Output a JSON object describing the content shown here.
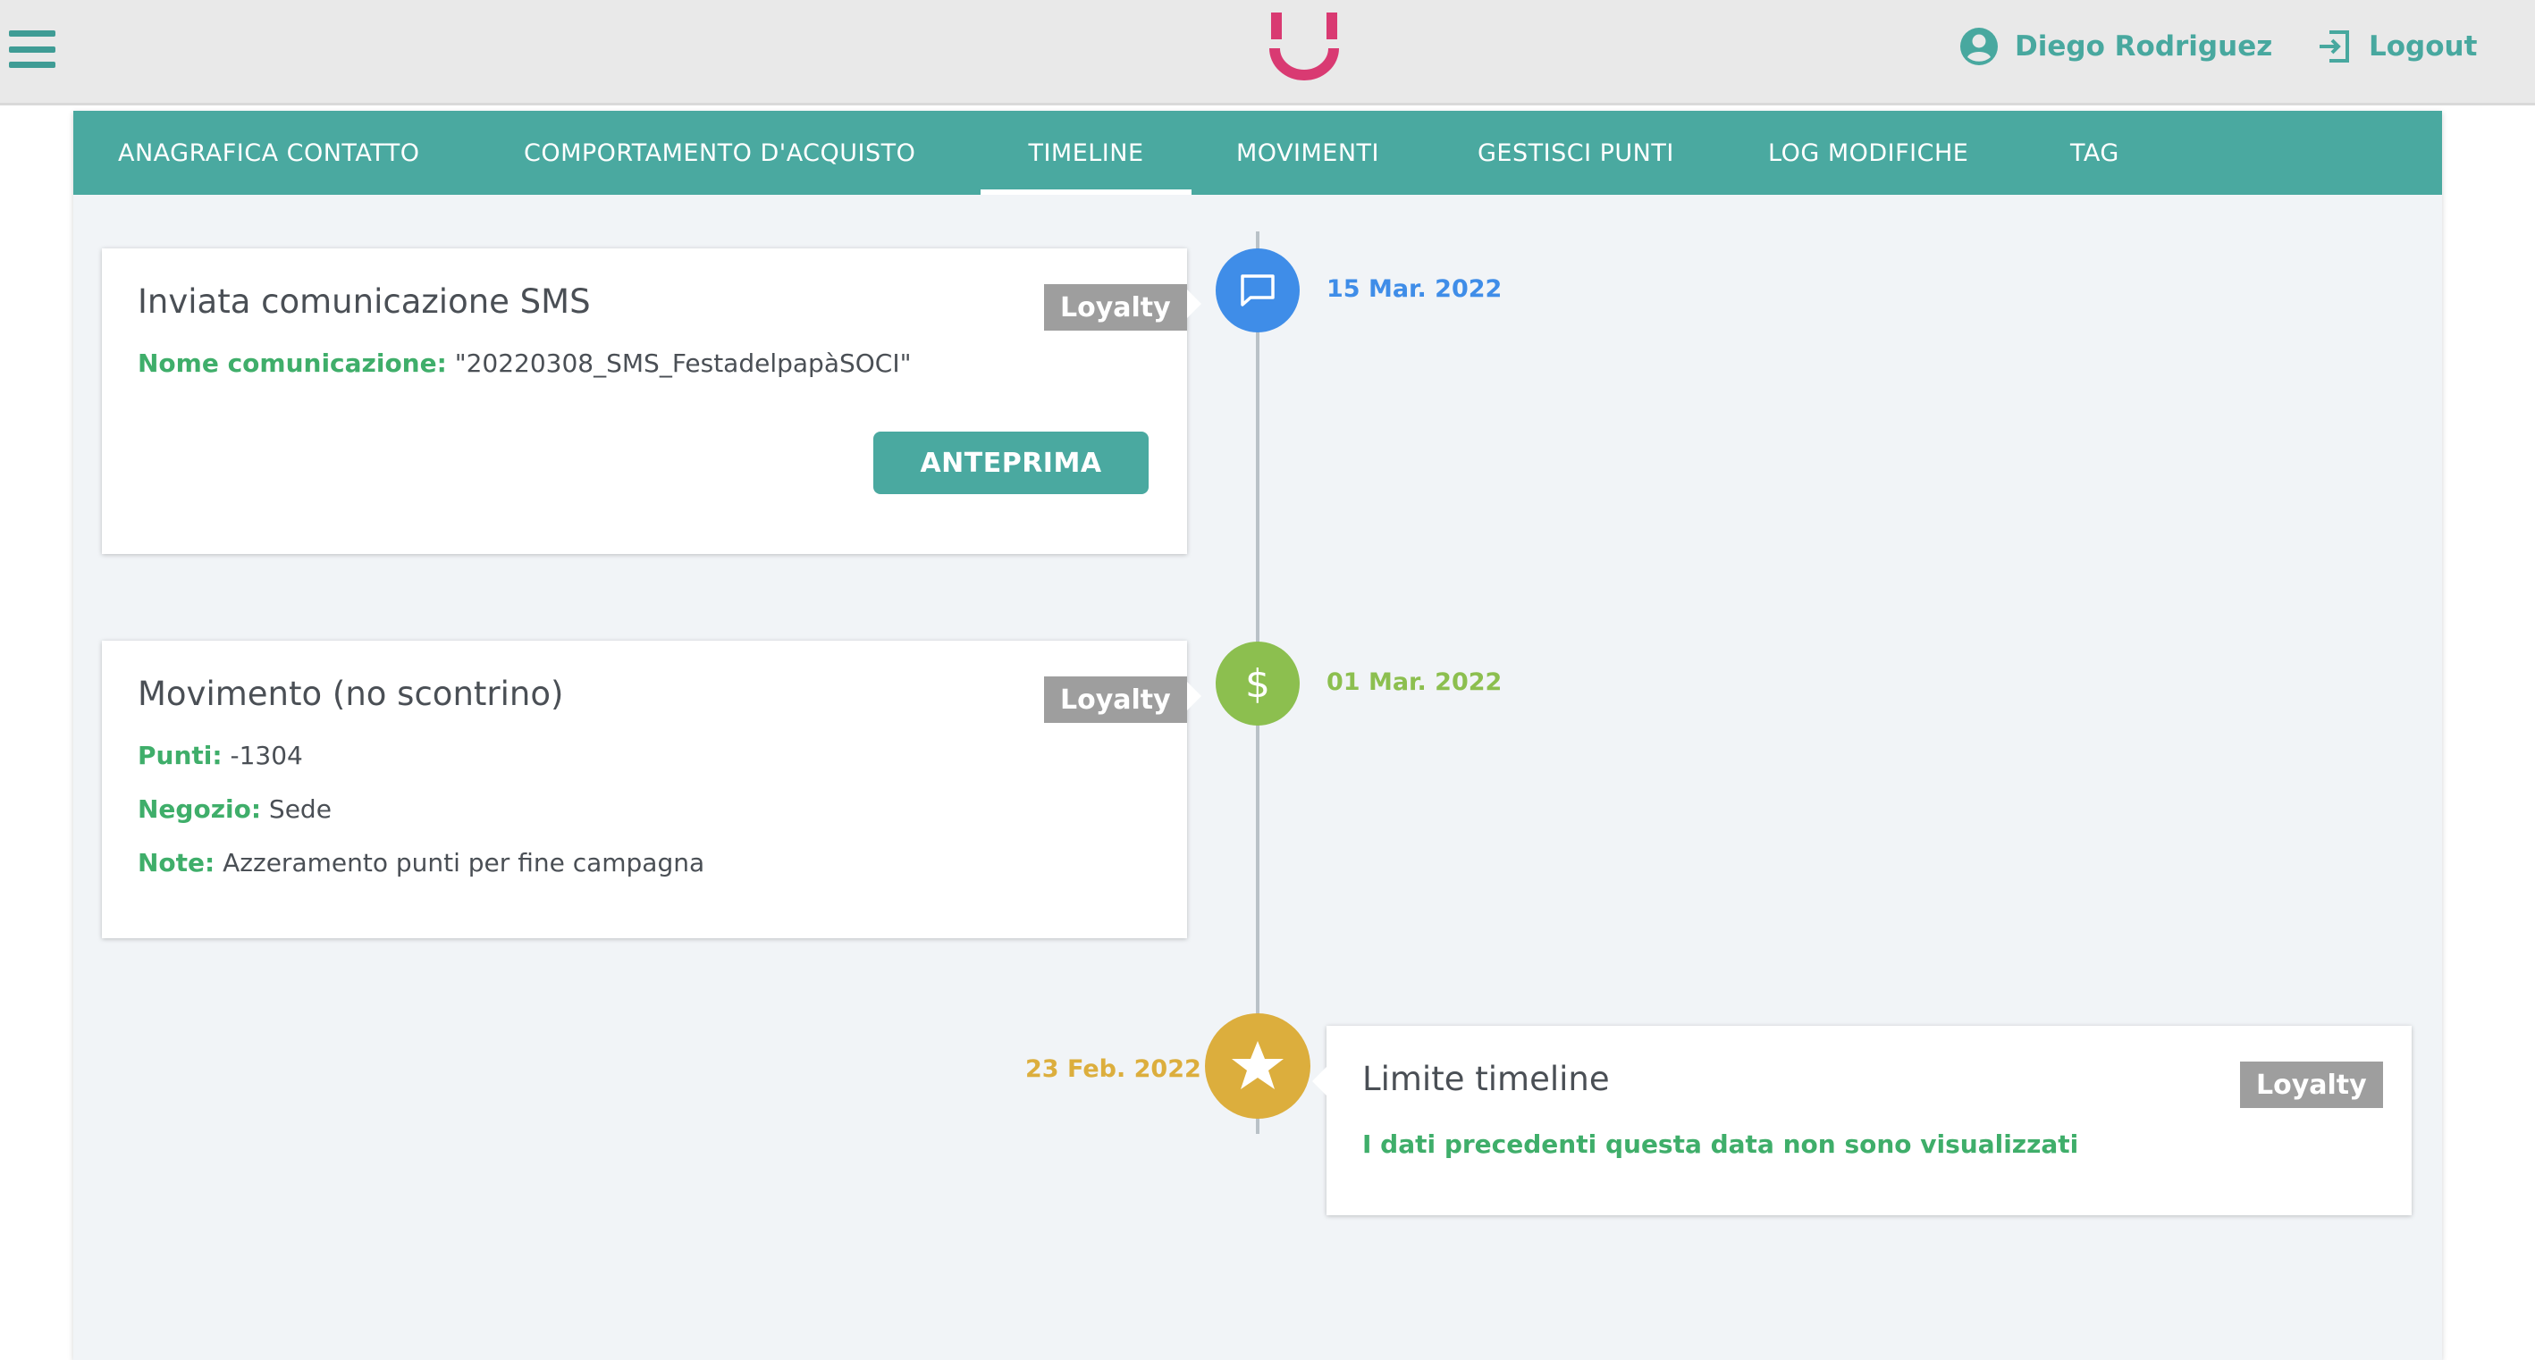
{
  "header": {
    "user_name": "Diego Rodriguez",
    "logout_label": "Logout"
  },
  "tabs": [
    {
      "label": "ANAGRAFICA CONTATTO"
    },
    {
      "label": "COMPORTAMENTO D'ACQUISTO"
    },
    {
      "label": "TIMELINE"
    },
    {
      "label": "MOVIMENTI"
    },
    {
      "label": "GESTISCI PUNTI"
    },
    {
      "label": "LOG MODIFICHE"
    },
    {
      "label": "TAG"
    }
  ],
  "timeline": {
    "events": [
      {
        "date": "15 Mar. 2022",
        "icon": "chat-icon",
        "color": "#3f8de8",
        "title": "Inviata comunicazione SMS",
        "badge": "Loyalty",
        "fields": [
          {
            "label": "Nome comunicazione:",
            "value": " \"20220308_SMS_FestadelpapàSOCI\""
          }
        ],
        "button": "ANTEPRIMA"
      },
      {
        "date": "01 Mar. 2022",
        "icon": "dollar-icon",
        "color": "#8cbf4f",
        "title": "Movimento (no scontrino)",
        "badge": "Loyalty",
        "fields": [
          {
            "label": "Punti:",
            "value": " -1304"
          },
          {
            "label": "Negozio:",
            "value": " Sede"
          },
          {
            "label": "Note:",
            "value": " Azzeramento punti per fine campagna"
          }
        ]
      },
      {
        "date": "23 Feb. 2022",
        "icon": "star-icon",
        "color": "#dcae3d",
        "title": "Limite timeline",
        "badge": "Loyalty",
        "notice": "I dati precedenti questa data non sono visualizzati"
      }
    ]
  },
  "colors": {
    "teal": "#4aa9a0",
    "green_label": "#3fae6a",
    "logo_pink": "#d93a72",
    "badge_grey": "#9e9e9e"
  }
}
